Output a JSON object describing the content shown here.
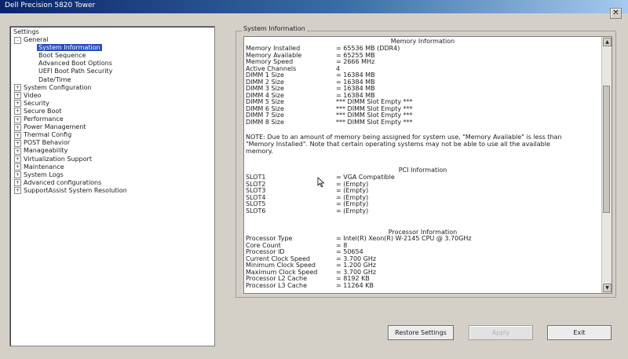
{
  "window": {
    "title": "Dell Precision 5820 Tower",
    "close_icon": "close-icon"
  },
  "settings_tree": {
    "root_label": "Settings",
    "general": {
      "label": "General",
      "children": [
        "System Information",
        "Boot Sequence",
        "Advanced Boot Options",
        "UEFI Boot Path Security",
        "Date/Time"
      ],
      "selected": "System Information"
    },
    "collapsed_items": [
      "System Configuration",
      "Video",
      "Security",
      "Secure Boot",
      "Performance",
      "Power Management",
      "Thermal Config",
      "POST Behavior",
      "Manageability",
      "Virtualization Support",
      "Maintenance",
      "System Logs",
      "Advanced configurations",
      "SupportAssist System Resolution"
    ]
  },
  "system_information": {
    "group_label": "System Information",
    "memory": {
      "heading": "Memory Information",
      "rows": [
        {
          "k": "Memory Installed",
          "v": "= 65536 MB (DDR4)"
        },
        {
          "k": "Memory Available",
          "v": "= 65255 MB"
        },
        {
          "k": "Memory Speed",
          "v": "= 2666 MHz"
        },
        {
          "k": "Active Channels",
          "v": "4"
        },
        {
          "k": "DIMM 1 Size",
          "v": "= 16384 MB"
        },
        {
          "k": "DIMM 2 Size",
          "v": "= 16384 MB"
        },
        {
          "k": "DIMM 3 Size",
          "v": "= 16384 MB"
        },
        {
          "k": "DIMM 4 Size",
          "v": "= 16384 MB"
        },
        {
          "k": "DIMM 5 Size",
          "v": "*** DIMM Slot Empty ***"
        },
        {
          "k": "DIMM 6 Size",
          "v": "*** DIMM Slot Empty ***"
        },
        {
          "k": "DIMM 7 Size",
          "v": "*** DIMM Slot Empty ***"
        },
        {
          "k": "DIMM 8 Size",
          "v": "*** DIMM Slot Empty ***"
        }
      ],
      "note": "NOTE: Due to an amount of memory being assigned for system use, \"Memory Available\" is less than \"Memory Installed\". Note that certain operating systems may not be able to use all the available memory."
    },
    "pci": {
      "heading": "PCI Information",
      "rows": [
        {
          "k": "SLOT1",
          "v": "= VGA Compatible"
        },
        {
          "k": "SLOT2",
          "v": "= (Empty)"
        },
        {
          "k": "SLOT3",
          "v": "= (Empty)"
        },
        {
          "k": "SLOT4",
          "v": "= (Empty)"
        },
        {
          "k": "SLOT5",
          "v": "= (Empty)"
        },
        {
          "k": "SLOT6",
          "v": "= (Empty)"
        }
      ]
    },
    "processor": {
      "heading": "Processor Information",
      "rows": [
        {
          "k": "Processor Type",
          "v": "= Intel(R) Xeon(R) W-2145 CPU @ 3.70GHz"
        },
        {
          "k": "Core Count",
          "v": "= 8"
        },
        {
          "k": "Processor ID",
          "v": "= 50654"
        },
        {
          "k": "Current Clock Speed",
          "v": "= 3.700 GHz"
        },
        {
          "k": "Minimum Clock Speed",
          "v": "= 1.200 GHz"
        },
        {
          "k": "Maximum Clock Speed",
          "v": "= 3.700 GHz"
        },
        {
          "k": "Processor L2 Cache",
          "v": "= 8192 KB"
        },
        {
          "k": "Processor L3 Cache",
          "v": "= 11264 KB"
        }
      ]
    }
  },
  "buttons": {
    "restore": "Restore Settings",
    "apply": "Apply",
    "exit": "Exit"
  },
  "colors": {
    "selection": "#2a4ebe",
    "background": "#d4d0c8"
  }
}
